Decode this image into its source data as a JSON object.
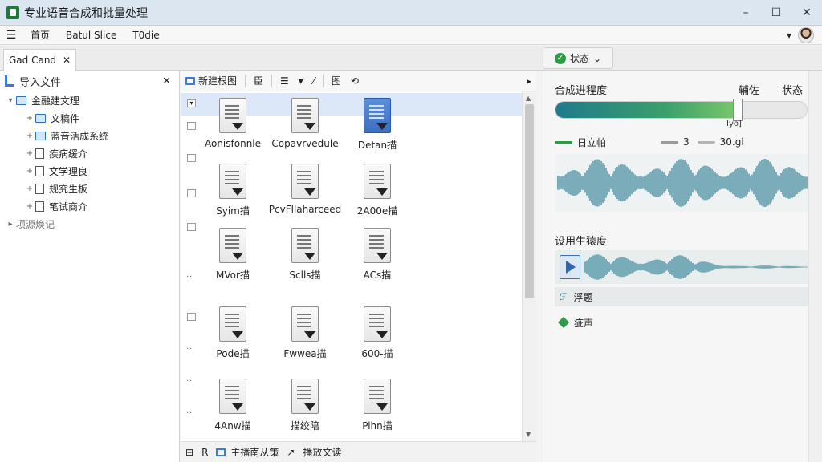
{
  "window": {
    "title": "专业语音合成和批量处理",
    "controls": [
      "–",
      "☐",
      "✕"
    ]
  },
  "menu": {
    "items": [
      "首页",
      "Batul Slice",
      "T0die"
    ],
    "dropdown_glyph": "▾"
  },
  "tabs": {
    "doc_tab": "Gad Cand",
    "doc_tab_close": "✕",
    "status_tab": "状态",
    "status_tab_glyph": "✓",
    "status_tab_chevron": "⌄"
  },
  "left_panel": {
    "title": "导入文件",
    "close": "✕",
    "tree": [
      {
        "label": "金融建文理",
        "level": 0,
        "icon": "folder-icon",
        "expander": "▾"
      },
      {
        "label": "文稿件",
        "level": 1,
        "icon": "folder-icon",
        "expander": "+"
      },
      {
        "label": "蓝音活成系统",
        "level": 1,
        "icon": "folder-icon",
        "expander": "+"
      },
      {
        "label": "疾病缓介",
        "level": 1,
        "icon": "doc-icon",
        "expander": "+"
      },
      {
        "label": "文学理良",
        "level": 1,
        "icon": "doc-icon",
        "expander": "+"
      },
      {
        "label": "规究生板",
        "level": 1,
        "icon": "doc-icon",
        "expander": "+"
      },
      {
        "label": "笔试商介",
        "level": 1,
        "icon": "image-doc-icon",
        "expander": "+"
      },
      {
        "label": "项源焕记",
        "level": 0,
        "icon": "none",
        "expander": "▸"
      }
    ]
  },
  "toolbar": {
    "items": [
      "新建根图",
      "臣",
      "☰",
      "▾",
      "⁄",
      "图",
      "⟲"
    ],
    "more": "▸"
  },
  "files": [
    {
      "name": "Aonisfonnle",
      "selected": false
    },
    {
      "name": "Copavrvedule",
      "selected": false
    },
    {
      "name": "Detan描",
      "selected": true
    },
    {
      "name": "Syim描",
      "selected": false
    },
    {
      "name": "PcvFllaharceed",
      "selected": false
    },
    {
      "name": "2A00e描",
      "selected": false
    },
    {
      "name": "MVor描",
      "selected": false
    },
    {
      "name": "Sclls描",
      "selected": false
    },
    {
      "name": "ACs描",
      "selected": false
    },
    {
      "name": "Pode描",
      "selected": false
    },
    {
      "name": "Fwwea描",
      "selected": false
    },
    {
      "name": "600-描",
      "selected": false
    },
    {
      "name": "4Anw描",
      "selected": false
    },
    {
      "name": "描绞陪",
      "selected": false
    },
    {
      "name": "Pihn描",
      "selected": false
    }
  ],
  "mid_status": {
    "left_icons": [
      "⊟",
      "R"
    ],
    "label1": "主播南从策",
    "sep": "↗",
    "label2": "播放文读"
  },
  "right_panel": {
    "progress_heading": "合成进程度",
    "col1": "辅佐",
    "col2": "状态",
    "progress_value": 0.73,
    "progress_label": "Iyo]",
    "legend": [
      {
        "label": "日立帕",
        "color": "#2e9b45"
      },
      {
        "label": "3",
        "color": "#9a9a9a"
      },
      {
        "label": "30.gl",
        "color": "#b5b5b5"
      }
    ],
    "wave_heading": "设用生猿度",
    "item1": "浮题",
    "item1_icon": "ℱ",
    "item2": "疵声",
    "wave_color": "#2f7f96"
  }
}
